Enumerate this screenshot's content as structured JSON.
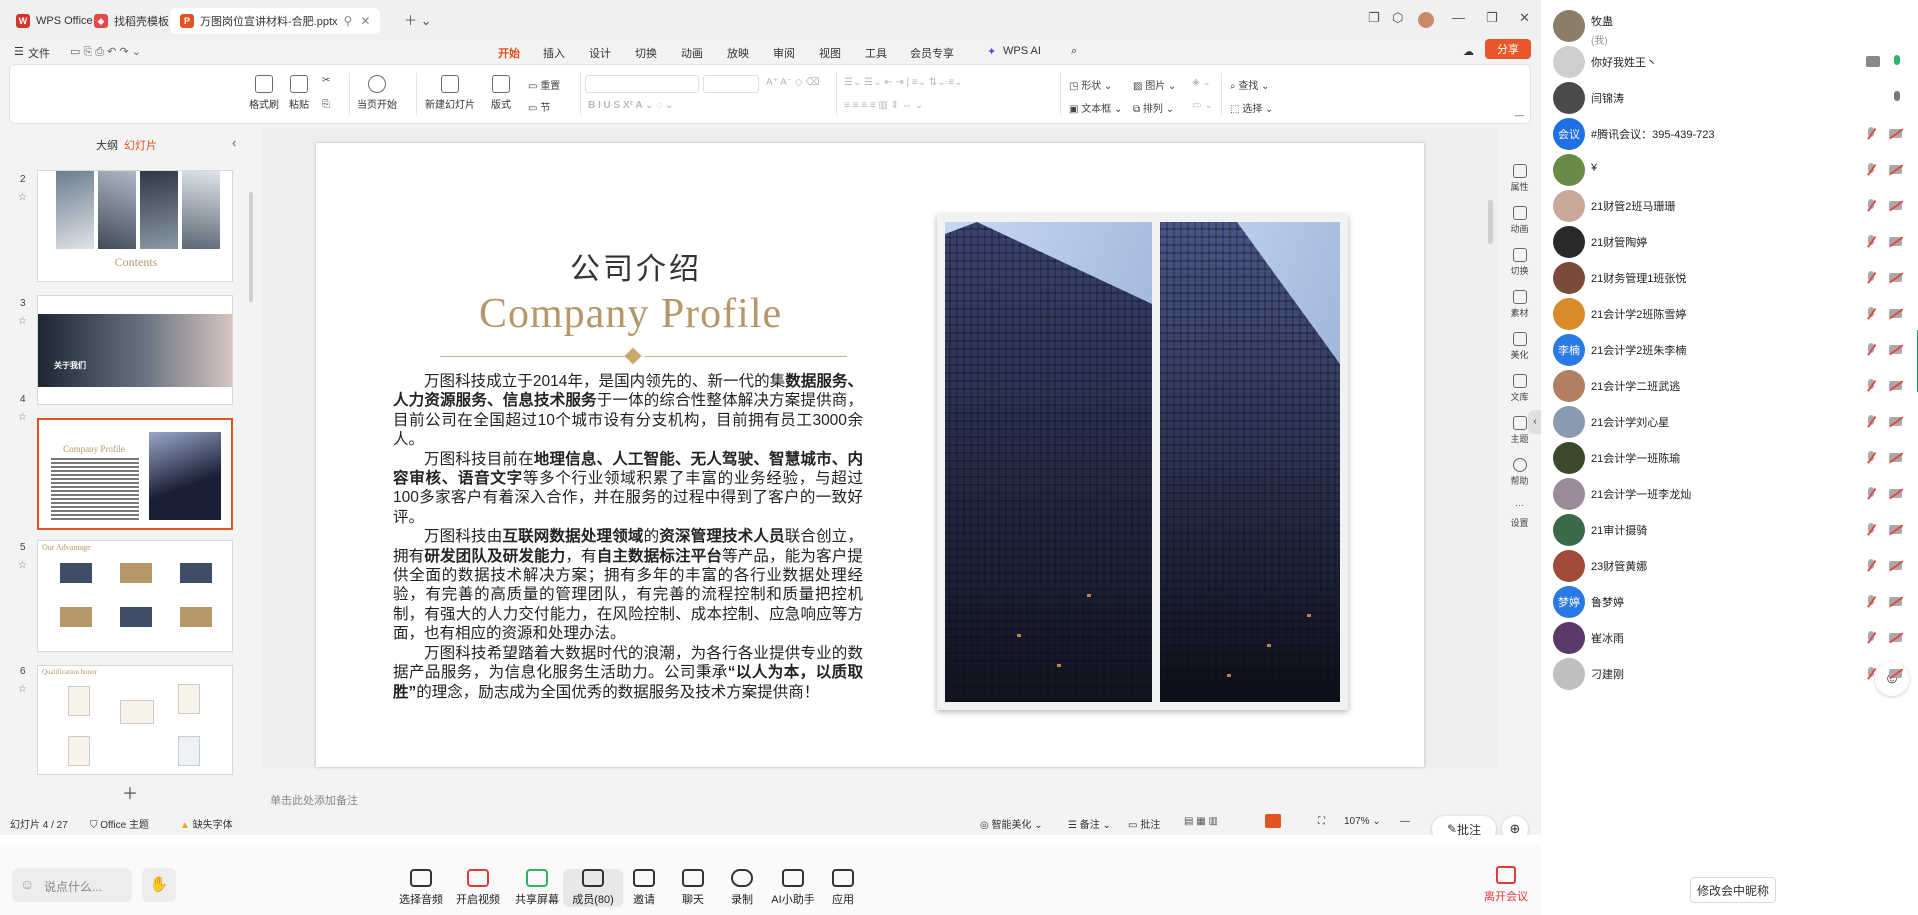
{
  "tabs": [
    {
      "label": "WPS Office",
      "color": "#d9342b"
    },
    {
      "label": "找稻壳模板",
      "color": "#e24a4a"
    },
    {
      "label": "万图岗位宣讲材料-合肥.pptx",
      "color": "#e2531e"
    }
  ],
  "menu": {
    "file": "文件",
    "items": [
      "开始",
      "插入",
      "设计",
      "切换",
      "动画",
      "放映",
      "审阅",
      "视图",
      "工具",
      "会员专享",
      "WPS AI"
    ],
    "active": "开始",
    "share": "分享"
  },
  "ribbon": {
    "format_painter": "格式刷",
    "paste": "粘贴",
    "play_from_current": "当页开始",
    "new_slide": "新建幻灯片",
    "layout": "版式",
    "section": "节",
    "reset": "重置",
    "shape": "形状",
    "picture": "图片",
    "textbox": "文本框",
    "arrange": "排列",
    "find": "查找",
    "select": "选择"
  },
  "slidepanel": {
    "tab_outline": "大纲",
    "tab_slides": "幻灯片",
    "slides": [
      {
        "num": "2",
        "caption": "Contents"
      },
      {
        "num": "3",
        "caption": "关于我们"
      },
      {
        "num": "4",
        "caption": "Company Profile"
      },
      {
        "num": "5",
        "caption": "Our Advantage"
      },
      {
        "num": "6",
        "caption": "Qualification honor"
      }
    ]
  },
  "slide": {
    "title_cn": "公司介绍",
    "title_en": "Company Profile",
    "paragraphs": [
      [
        {
          "t": "万图科技成立于2014年，是国内领先的、新一代的集"
        },
        {
          "t": "数据服务、人力资源服务、信息技术服务",
          "b": true
        },
        {
          "t": "于一体的综合性整体解决方案提供商，目前公司在全国超过10个城市设有分支机构，目前拥有员工3000余人。"
        }
      ],
      [
        {
          "t": "万图科技目前在"
        },
        {
          "t": "地理信息、人工智能、无人驾驶、智慧城市、内容审核、语音文字",
          "b": true
        },
        {
          "t": "等多个行业领域积累了丰富的业务经验，与超过100多家客户有着深入合作，并在服务的过程中得到了客户的一致好评。"
        }
      ],
      [
        {
          "t": "万图科技由"
        },
        {
          "t": "互联网数据处理领域",
          "b": true
        },
        {
          "t": "的"
        },
        {
          "t": "资深管理技术人员",
          "b": true
        },
        {
          "t": "联合创立，拥有"
        },
        {
          "t": "研发团队及研发能力",
          "b": true
        },
        {
          "t": "，有"
        },
        {
          "t": "自主数据标注平台",
          "b": true
        },
        {
          "t": "等产品，能为客户提供全面的数据技术解决方案；拥有多年的丰富的各行业数据处理经验，有完善的高质量的管理团队，有完善的流程控制和质量把控机制，有强大的人力交付能力，在风险控制、成本控制、应急响应等方面，也有相应的资源和处理办法。"
        }
      ],
      [
        {
          "t": "万图科技希望踏着大数据时代的浪潮，为各行各业提供专业的数据产品服务，为信息化服务生活助力。公司秉承"
        },
        {
          "t": "“以人为本，以质取胜”",
          "b": true
        },
        {
          "t": "的理念，励志成为全国优秀的数据服务及技术方案提供商！"
        }
      ]
    ]
  },
  "notes_placeholder": "单击此处添加备注",
  "rightrail": [
    "属性",
    "动画",
    "切换",
    "素材",
    "美化",
    "文库",
    "主题",
    "帮助",
    "设置"
  ],
  "status": {
    "slide_counter": "幻灯片 4 / 27",
    "theme": "Office 主题",
    "missing_font": "缺失字体",
    "smart_beautify": "智能美化",
    "notes": "备注",
    "comment": "批注",
    "zoom": "107%",
    "annotate_btn": "批注"
  },
  "participants": [
    {
      "name": "牧蛊",
      "sub": "(我)",
      "avatar": "img",
      "color": "#8a7d6a",
      "mic": "none",
      "cam": "none"
    },
    {
      "name": "你好我姓王丶",
      "avatar": "img",
      "color": "#cfcfcf",
      "mic": "on",
      "cam": "share"
    },
    {
      "name": "闫锦涛",
      "avatar": "img",
      "color": "#4a4a4a",
      "mic": "grey",
      "cam": "none"
    },
    {
      "name": "#腾讯会议：395-439-723",
      "avatar": "text",
      "avatar_text": "会议",
      "color": "#1f6fe5",
      "mic": "off",
      "cam": "off"
    },
    {
      "name": "¥",
      "avatar": "img",
      "color": "#6a8a4a",
      "mic": "off",
      "cam": "off"
    },
    {
      "name": "21财管2班马珊珊",
      "avatar": "img",
      "color": "#c9a89a",
      "mic": "off",
      "cam": "off"
    },
    {
      "name": "21财管陶婷",
      "avatar": "img",
      "color": "#2a2a2a",
      "mic": "off",
      "cam": "off"
    },
    {
      "name": "21财务管理1班张悦",
      "avatar": "img",
      "color": "#7a4a3a",
      "mic": "off",
      "cam": "off"
    },
    {
      "name": "21会计学2班陈雪婷",
      "avatar": "img",
      "color": "#d98a2a",
      "mic": "off",
      "cam": "off"
    },
    {
      "name": "21会计学2班朱李楠",
      "avatar": "text",
      "avatar_text": "李楠",
      "color": "#2a7ae5",
      "mic": "off",
      "cam": "off"
    },
    {
      "name": "21会计学二班武逃",
      "avatar": "img",
      "color": "#b08060",
      "mic": "off",
      "cam": "off"
    },
    {
      "name": "21会计学刘心星",
      "avatar": "img",
      "color": "#8a9ab0",
      "mic": "off",
      "cam": "off"
    },
    {
      "name": "21会计学一班陈瑜",
      "avatar": "img",
      "color": "#3a4a2a",
      "mic": "off",
      "cam": "off"
    },
    {
      "name": "21会计学一班李龙灿",
      "avatar": "img",
      "color": "#9a8a9a",
      "mic": "off",
      "cam": "off"
    },
    {
      "name": "21审计摄骑",
      "avatar": "img",
      "color": "#3a6a4a",
      "mic": "off",
      "cam": "off"
    },
    {
      "name": "23财管黄娜",
      "avatar": "img",
      "color": "#a04a3a",
      "mic": "off",
      "cam": "off"
    },
    {
      "name": "鲁梦婷",
      "avatar": "text",
      "avatar_text": "梦婷",
      "color": "#2a7ae5",
      "mic": "off",
      "cam": "off"
    },
    {
      "name": "崔冰雨",
      "avatar": "img",
      "color": "#5a3a6a",
      "mic": "off",
      "cam": "off"
    },
    {
      "name": "刁建刚",
      "avatar": "img",
      "color": "#c0c0c0",
      "mic": "off",
      "cam": "off"
    }
  ],
  "rename_button": "修改会中昵称",
  "meeting_bar": {
    "chat_placeholder": "说点什么...",
    "buttons": [
      {
        "label": "选择音频",
        "icon": "headset-icon"
      },
      {
        "label": "开启视频",
        "icon": "video-off-icon"
      },
      {
        "label": "共享屏幕",
        "icon": "share-screen-icon"
      },
      {
        "label": "成员(80)",
        "icon": "members-icon"
      },
      {
        "label": "邀请",
        "icon": "invite-icon"
      },
      {
        "label": "聊天",
        "icon": "chat-icon"
      },
      {
        "label": "录制",
        "icon": "record-icon"
      },
      {
        "label": "AI小助手",
        "icon": "ai-assistant-icon"
      },
      {
        "label": "应用",
        "icon": "apps-icon"
      }
    ],
    "leave": "离开会议"
  },
  "colors": {
    "accent": "#e2531e",
    "gold": "#b5976a",
    "leave": "#e03b3b"
  }
}
